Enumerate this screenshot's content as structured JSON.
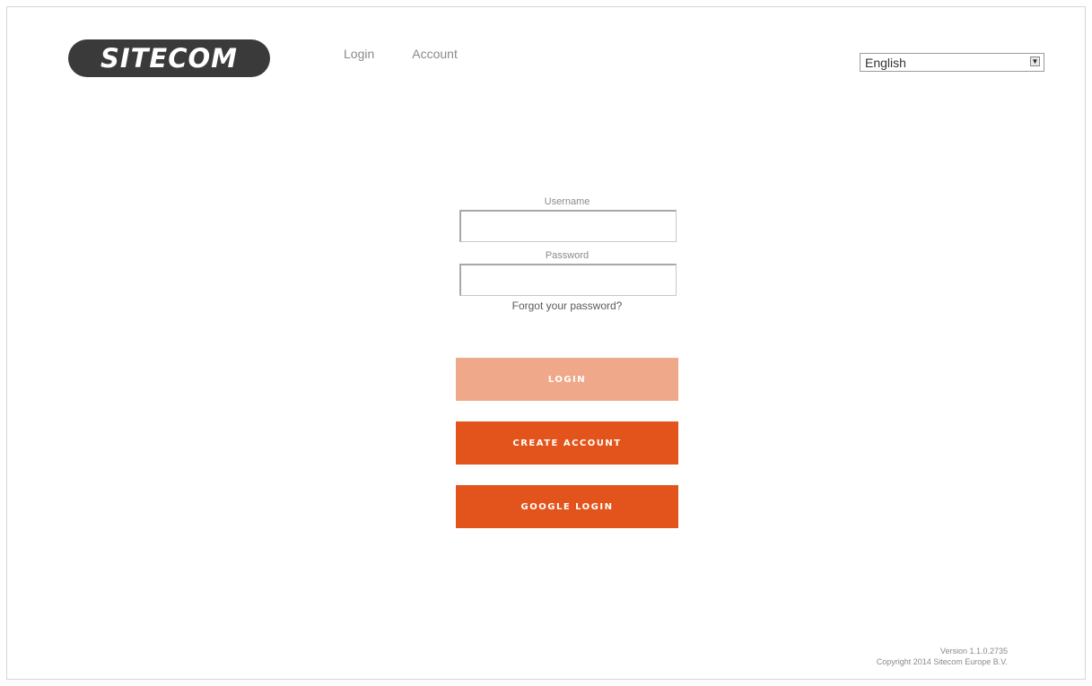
{
  "header": {
    "logo_text": "SITECOM",
    "nav": {
      "login_label": "Login",
      "account_label": "Account"
    },
    "language": {
      "selected": "English"
    }
  },
  "form": {
    "username_label": "Username",
    "username_value": "",
    "password_label": "Password",
    "password_value": "",
    "forgot_label": "Forgot your password?"
  },
  "buttons": {
    "login_label": "LOGIN",
    "create_account_label": "CREATE ACCOUNT",
    "google_login_label": "GOOGLE LOGIN"
  },
  "footer": {
    "version": "Version 1.1.0.2735",
    "copyright": "Copyright 2014 Sitecom Europe B.V."
  },
  "colors": {
    "accent": "#e2541b",
    "accent_disabled": "#f0a88a",
    "logo_bg": "#3a3a3a"
  }
}
